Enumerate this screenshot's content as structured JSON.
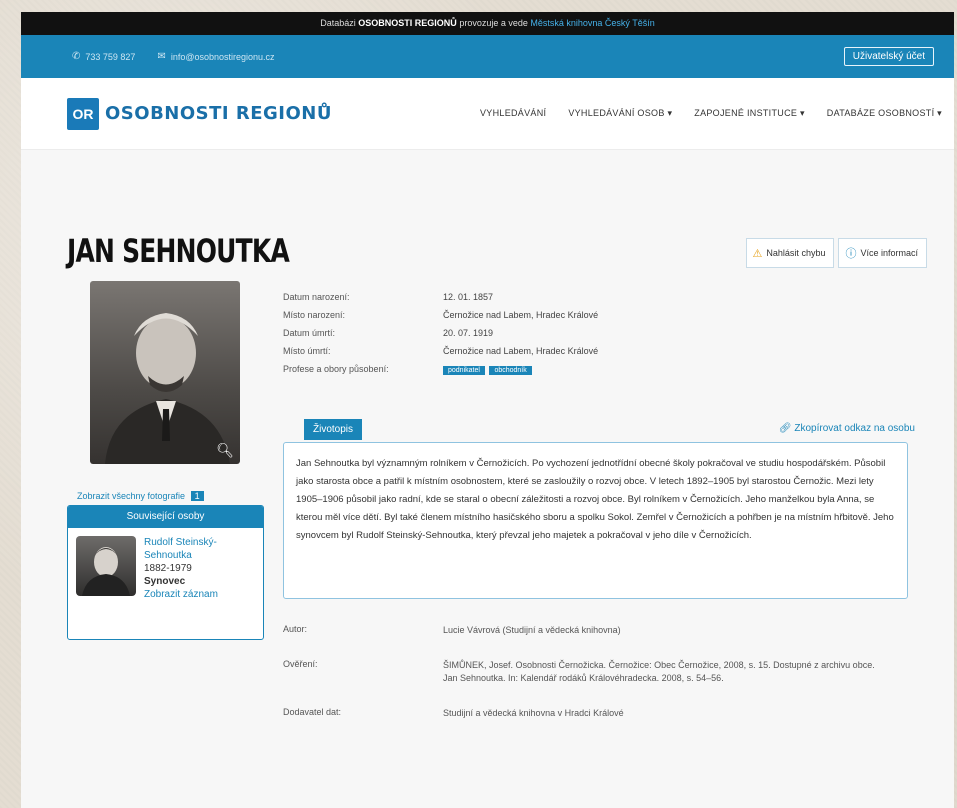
{
  "notice": {
    "prefix": "Databázi",
    "brand": "OSOBNOSTI REGIONŮ",
    "middle": "provozuje a vede",
    "link": "Městská knihovna Český Těšín"
  },
  "contact": {
    "phone": "733 759 827",
    "email": "info@osobnostiregionu.cz",
    "login_label": "Uživatelský účet"
  },
  "brand": {
    "mark": "OR",
    "name": "OSOBNOSTI REGIONŮ"
  },
  "nav": [
    {
      "label": "VYHLEDÁVÁNÍ"
    },
    {
      "label": "VYHLEDÁVÁNÍ OSOB ▾"
    },
    {
      "label": "ZAPOJENÉ INSTITUCE ▾"
    },
    {
      "label": "DATABÁZE OSOBNOSTÍ ▾"
    }
  ],
  "person": {
    "name": "JAN SEHNOUTKA",
    "report_label": "Nahlásit chybu",
    "more_info_label": "Více informací",
    "show_photos_label": "Zobrazit všechny fotografie",
    "photo_count": "1"
  },
  "facts": [
    {
      "k": "Datum narození:",
      "v": "12. 01. 1857"
    },
    {
      "k": "Místo narození:",
      "v": "Černožice nad Labem, Hradec Králové"
    },
    {
      "k": "Datum úmrtí:",
      "v": "20. 07. 1919"
    },
    {
      "k": "Místo úmrtí:",
      "v": "Černožice nad Labem, Hradec Králové"
    },
    {
      "k": "Profese a obory působení:",
      "tags": [
        "podnikatel",
        "obchodník"
      ]
    }
  ],
  "related": {
    "title": "Související osoby",
    "name_line1": "Rudolf Steinský-",
    "name_line2": "Sehnoutka",
    "years": "1882-1979",
    "role": "Synovec",
    "link": "Zobrazit záznam"
  },
  "tabs": {
    "bio_label": "Životopis",
    "open_link": "Zkopírovat odkaz na osobu"
  },
  "bio_text": "Jan Sehnoutka byl významným rolníkem v Černožicích. Po vychození jednotřídní obecné školy pokračoval ve studiu hospodářském. Působil jako starosta obce a patřil k místním osobnostem, které se zasloužily o rozvoj obce. V letech 1892–1905 byl starostou Černožic. Mezi lety 1905–1906 působil jako radní, kde se staral o obecní záležitosti a rozvoj obce. Byl rolníkem v Černožicích. Jeho manželkou byla Anna, se kterou měl více dětí. Byl také členem místního hasičského sboru a spolku Sokol. Zemřel v Černožicích a pohřben je na místním hřbitově. Jeho synovcem byl Rudolf Steinský-Sehnoutka, který převzal jeho majetek a pokračoval v jeho díle v Černožicích.",
  "meta": [
    {
      "k": "Autor:",
      "v": "Lucie Vávrová (Studijní a vědecká knihovna)"
    },
    {
      "k": "Ověření:",
      "v": "ŠIMŮNEK, Josef. Osobnosti Černožicka. Černožice: Obec Černožice, 2008, s. 15. Dostupné z archivu obce. Jan Sehnoutka. In: Kalendář rodáků Královéhradecka. 2008, s. 54–56."
    },
    {
      "k": "Dodavatel dat:",
      "v": "Studijní a vědecká knihovna v Hradci Králové"
    }
  ]
}
